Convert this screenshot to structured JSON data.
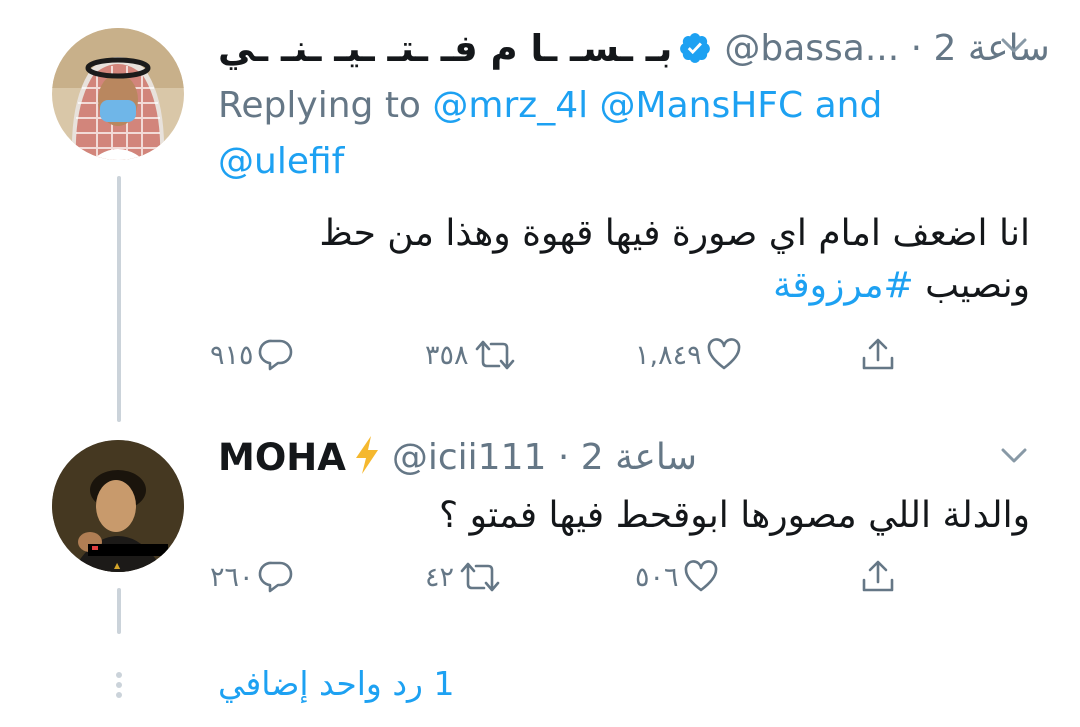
{
  "tweet1": {
    "display_name": "بـ ـسـ ـا م فـ ـتـ ـيـ ـنـ ـي",
    "handle_time": "@bassa... · 2 ساعة",
    "replying_prefix": "Replying to",
    "mentions_line1": "@mrz_4l @MansHFC",
    "and_word": "and",
    "mention_line2": "@ulefif",
    "text_line1": "انا اضعف امام اي صورة فيها قهوة وهذا من حظ",
    "text_line2_prefix": "ونصيب",
    "hashtag": "#مرزوقة",
    "replies": "٩١٥",
    "retweets": "٣٥٨",
    "likes": "١,٨٤٩"
  },
  "tweet2": {
    "display_name": "MOHA",
    "name_emoji": "⚡",
    "handle_time": "@icii111 · 2 ساعة",
    "text": "والدلة اللي مصورها ابوقحط فيها فمتو ؟",
    "replies": "٢٦٠",
    "retweets": "٤٢",
    "likes": "٥٠٦"
  },
  "more_replies": "1 رد واحد إضافي",
  "colors": {
    "accent": "#1da1f2",
    "muted": "#657786",
    "thread": "#cbd3da",
    "bolt": "#f5b82e"
  }
}
